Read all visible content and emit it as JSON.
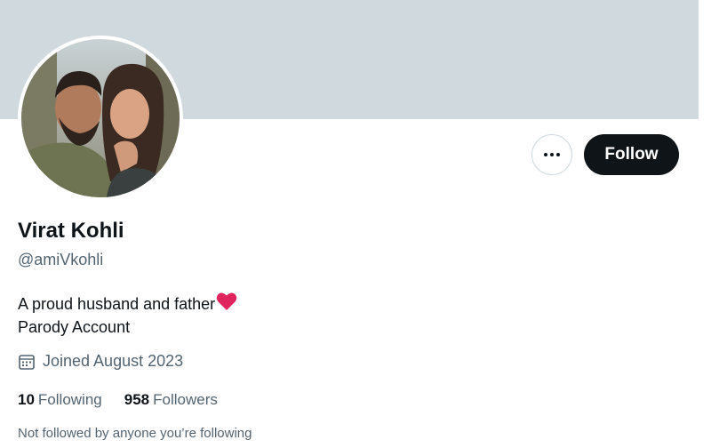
{
  "profile": {
    "name": "Virat Kohli",
    "handle": "@amiVkohli",
    "bio_line1": "A proud husband and father",
    "bio_line2": "Parody Account",
    "joined": "Joined August 2023",
    "following_count": "10",
    "following_label": "Following",
    "followers_count": "958",
    "followers_label": "Followers",
    "not_followed_text": "Not followed by anyone you’re following"
  },
  "actions": {
    "follow_label": "Follow",
    "more_icon": "more-horizontal-icon"
  },
  "colors": {
    "banner": "#cfd9de",
    "primary_text": "#0f1419",
    "secondary_text": "#536471",
    "heart": "#e0245e"
  }
}
